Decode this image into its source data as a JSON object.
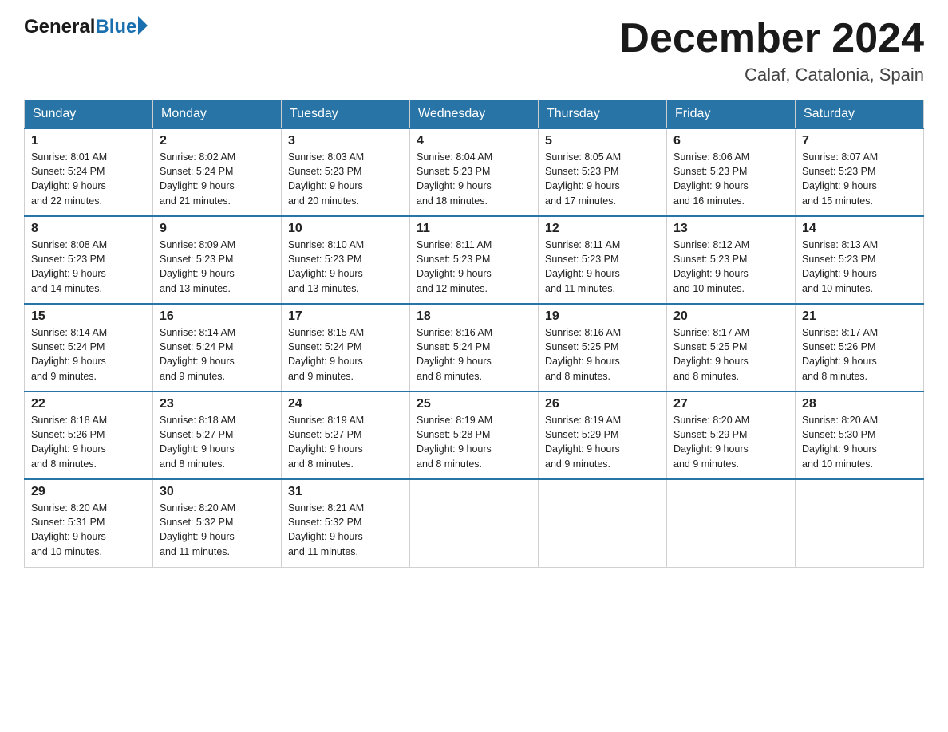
{
  "header": {
    "logo_general": "General",
    "logo_blue": "Blue",
    "month_title": "December 2024",
    "location": "Calaf, Catalonia, Spain"
  },
  "weekdays": [
    "Sunday",
    "Monday",
    "Tuesday",
    "Wednesday",
    "Thursday",
    "Friday",
    "Saturday"
  ],
  "weeks": [
    [
      {
        "day": "1",
        "sunrise": "8:01 AM",
        "sunset": "5:24 PM",
        "daylight": "9 hours and 22 minutes."
      },
      {
        "day": "2",
        "sunrise": "8:02 AM",
        "sunset": "5:24 PM",
        "daylight": "9 hours and 21 minutes."
      },
      {
        "day": "3",
        "sunrise": "8:03 AM",
        "sunset": "5:23 PM",
        "daylight": "9 hours and 20 minutes."
      },
      {
        "day": "4",
        "sunrise": "8:04 AM",
        "sunset": "5:23 PM",
        "daylight": "9 hours and 18 minutes."
      },
      {
        "day": "5",
        "sunrise": "8:05 AM",
        "sunset": "5:23 PM",
        "daylight": "9 hours and 17 minutes."
      },
      {
        "day": "6",
        "sunrise": "8:06 AM",
        "sunset": "5:23 PM",
        "daylight": "9 hours and 16 minutes."
      },
      {
        "day": "7",
        "sunrise": "8:07 AM",
        "sunset": "5:23 PM",
        "daylight": "9 hours and 15 minutes."
      }
    ],
    [
      {
        "day": "8",
        "sunrise": "8:08 AM",
        "sunset": "5:23 PM",
        "daylight": "9 hours and 14 minutes."
      },
      {
        "day": "9",
        "sunrise": "8:09 AM",
        "sunset": "5:23 PM",
        "daylight": "9 hours and 13 minutes."
      },
      {
        "day": "10",
        "sunrise": "8:10 AM",
        "sunset": "5:23 PM",
        "daylight": "9 hours and 13 minutes."
      },
      {
        "day": "11",
        "sunrise": "8:11 AM",
        "sunset": "5:23 PM",
        "daylight": "9 hours and 12 minutes."
      },
      {
        "day": "12",
        "sunrise": "8:11 AM",
        "sunset": "5:23 PM",
        "daylight": "9 hours and 11 minutes."
      },
      {
        "day": "13",
        "sunrise": "8:12 AM",
        "sunset": "5:23 PM",
        "daylight": "9 hours and 10 minutes."
      },
      {
        "day": "14",
        "sunrise": "8:13 AM",
        "sunset": "5:23 PM",
        "daylight": "9 hours and 10 minutes."
      }
    ],
    [
      {
        "day": "15",
        "sunrise": "8:14 AM",
        "sunset": "5:24 PM",
        "daylight": "9 hours and 9 minutes."
      },
      {
        "day": "16",
        "sunrise": "8:14 AM",
        "sunset": "5:24 PM",
        "daylight": "9 hours and 9 minutes."
      },
      {
        "day": "17",
        "sunrise": "8:15 AM",
        "sunset": "5:24 PM",
        "daylight": "9 hours and 9 minutes."
      },
      {
        "day": "18",
        "sunrise": "8:16 AM",
        "sunset": "5:24 PM",
        "daylight": "9 hours and 8 minutes."
      },
      {
        "day": "19",
        "sunrise": "8:16 AM",
        "sunset": "5:25 PM",
        "daylight": "9 hours and 8 minutes."
      },
      {
        "day": "20",
        "sunrise": "8:17 AM",
        "sunset": "5:25 PM",
        "daylight": "9 hours and 8 minutes."
      },
      {
        "day": "21",
        "sunrise": "8:17 AM",
        "sunset": "5:26 PM",
        "daylight": "9 hours and 8 minutes."
      }
    ],
    [
      {
        "day": "22",
        "sunrise": "8:18 AM",
        "sunset": "5:26 PM",
        "daylight": "9 hours and 8 minutes."
      },
      {
        "day": "23",
        "sunrise": "8:18 AM",
        "sunset": "5:27 PM",
        "daylight": "9 hours and 8 minutes."
      },
      {
        "day": "24",
        "sunrise": "8:19 AM",
        "sunset": "5:27 PM",
        "daylight": "9 hours and 8 minutes."
      },
      {
        "day": "25",
        "sunrise": "8:19 AM",
        "sunset": "5:28 PM",
        "daylight": "9 hours and 8 minutes."
      },
      {
        "day": "26",
        "sunrise": "8:19 AM",
        "sunset": "5:29 PM",
        "daylight": "9 hours and 9 minutes."
      },
      {
        "day": "27",
        "sunrise": "8:20 AM",
        "sunset": "5:29 PM",
        "daylight": "9 hours and 9 minutes."
      },
      {
        "day": "28",
        "sunrise": "8:20 AM",
        "sunset": "5:30 PM",
        "daylight": "9 hours and 10 minutes."
      }
    ],
    [
      {
        "day": "29",
        "sunrise": "8:20 AM",
        "sunset": "5:31 PM",
        "daylight": "9 hours and 10 minutes."
      },
      {
        "day": "30",
        "sunrise": "8:20 AM",
        "sunset": "5:32 PM",
        "daylight": "9 hours and 11 minutes."
      },
      {
        "day": "31",
        "sunrise": "8:21 AM",
        "sunset": "5:32 PM",
        "daylight": "9 hours and 11 minutes."
      },
      null,
      null,
      null,
      null
    ]
  ],
  "labels": {
    "sunrise_prefix": "Sunrise: ",
    "sunset_prefix": "Sunset: ",
    "daylight_prefix": "Daylight: "
  }
}
